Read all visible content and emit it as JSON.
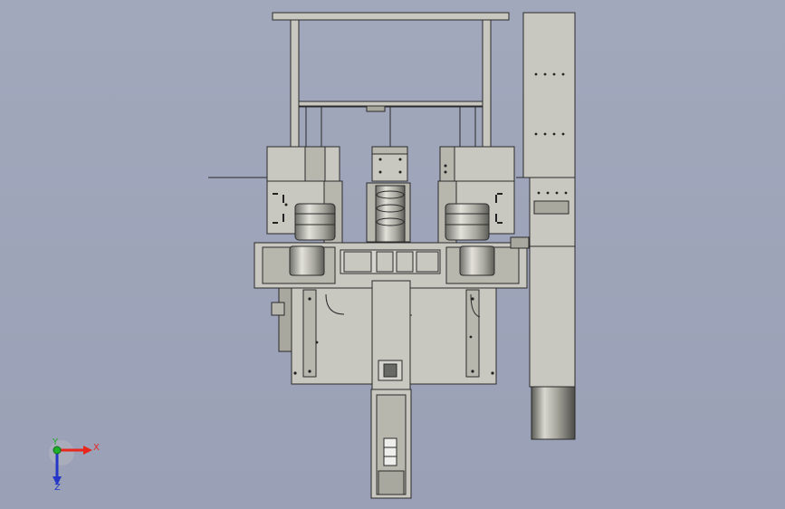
{
  "triad": {
    "x_label": "X",
    "y_label": "Y",
    "z_label": "Z",
    "x_color": "#e8261e",
    "y_color": "#1fae2a",
    "z_color": "#2336c8"
  },
  "colors": {
    "background": "#9ea4b8",
    "metal": "#c9c8c0",
    "metal_dark": "#a9a89f",
    "outline": "#2a2a2a",
    "hole": "#222222"
  }
}
